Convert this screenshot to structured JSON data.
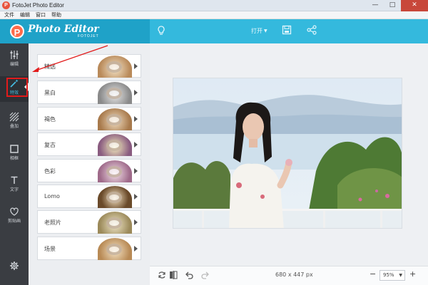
{
  "window": {
    "title": "FotoJet Photo Editor",
    "app_icon_letter": "P",
    "controls": {
      "minimize": "—",
      "maximize": "□",
      "close": "✕"
    }
  },
  "menu": [
    "文件",
    "编辑",
    "窗口",
    "帮助"
  ],
  "header": {
    "logo_letter": "P",
    "logo_text": "Photo Editor",
    "logo_sub": "FOTOJET",
    "open_label": "打开",
    "icons": [
      "lightbulb-icon",
      "save-icon",
      "share-icon"
    ]
  },
  "sidebar": {
    "items": [
      {
        "label": "编辑",
        "icon": "sliders-icon"
      },
      {
        "label": "特效",
        "icon": "magic-wand-icon",
        "active": true
      },
      {
        "label": "叠加",
        "icon": "overlay-icon"
      },
      {
        "label": "相框",
        "icon": "frame-icon"
      },
      {
        "label": "文字",
        "icon": "text-icon"
      },
      {
        "label": "剪贴画",
        "icon": "heart-icon"
      }
    ],
    "settings_icon": "gear-icon"
  },
  "effects": [
    {
      "label": "精选",
      "tint": "#b98a5a"
    },
    {
      "label": "黑白",
      "tint": "#8a8a8a"
    },
    {
      "label": "褐色",
      "tint": "#a87a4c"
    },
    {
      "label": "复古",
      "tint": "#8a5c80"
    },
    {
      "label": "色彩",
      "tint": "#9f6a8a"
    },
    {
      "label": "Lomo",
      "tint": "#6a4a2a"
    },
    {
      "label": "老照片",
      "tint": "#9c8a5a"
    },
    {
      "label": "场景",
      "tint": "#b88a55"
    }
  ],
  "bottom": {
    "dimensions": "680 x 447 px",
    "zoom": "95%",
    "zoom_minus": "−",
    "zoom_plus": "+"
  },
  "colors": {
    "header": "#34b9dd",
    "logo_bg": "#1fa2c8",
    "sidebar": "#3a3d42",
    "accent": "#47c0e6",
    "annotation": "#e21b1b"
  }
}
